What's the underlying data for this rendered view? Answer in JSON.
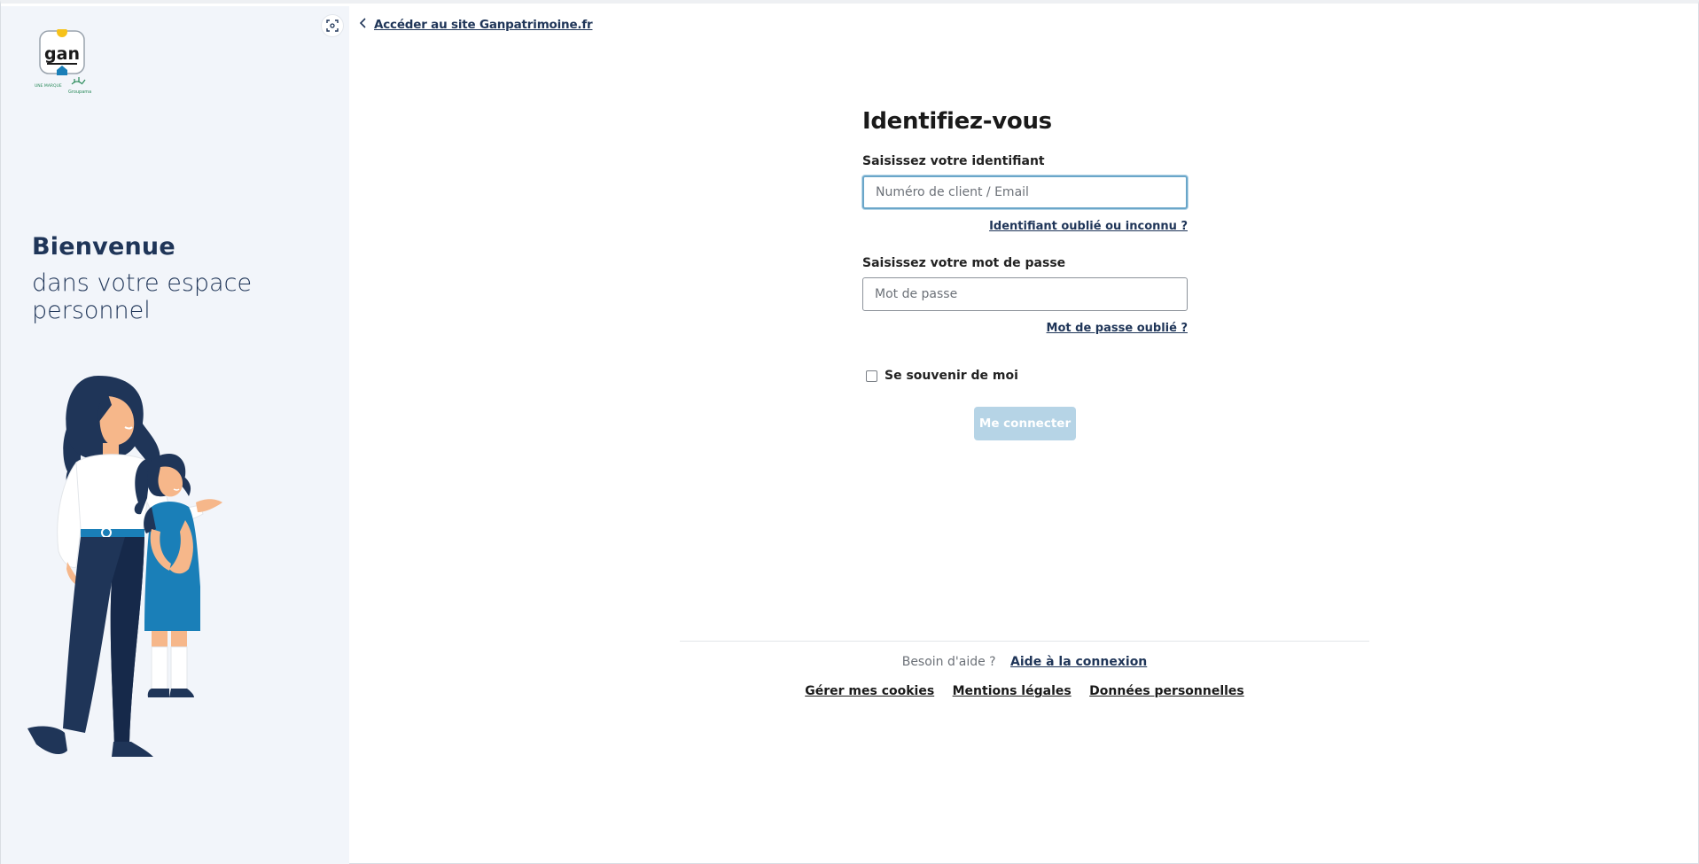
{
  "brand": {
    "logo_text": "gan",
    "logo_subtitle": "une marque Groupama"
  },
  "sidebar": {
    "welcome_title": "Bienvenue",
    "welcome_subtitle": "dans votre espace personnel"
  },
  "header": {
    "back_link": "Accéder au site Ganpatrimoine.fr"
  },
  "login_form": {
    "title": "Identifiez-vous",
    "identifier_label": "Saisissez votre identifiant",
    "identifier_placeholder": "Numéro de client / Email",
    "identifier_forgot": "Identifiant oublié ou inconnu ?",
    "password_label": "Saisissez votre mot de passe",
    "password_placeholder": "Mot de passe",
    "password_forgot": "Mot de passe oublié ?",
    "remember_label": "Se souvenir de moi",
    "submit_label": "Me connecter"
  },
  "footer": {
    "help_question": "Besoin d'aide ?",
    "help_link": "Aide à la connexion",
    "links": [
      "Gérer mes cookies",
      "Mentions légales",
      "Données personnelles"
    ]
  },
  "colors": {
    "navy": "#1f3558",
    "sidebar_bg": "#f2f5fa",
    "button_disabled": "#b6d4e6",
    "focus_border": "#6aa6c9",
    "gan_blue": "#1a7fb8"
  },
  "icons": [
    "focus-mode-icon",
    "chevron-left-icon",
    "checkbox-icon"
  ]
}
